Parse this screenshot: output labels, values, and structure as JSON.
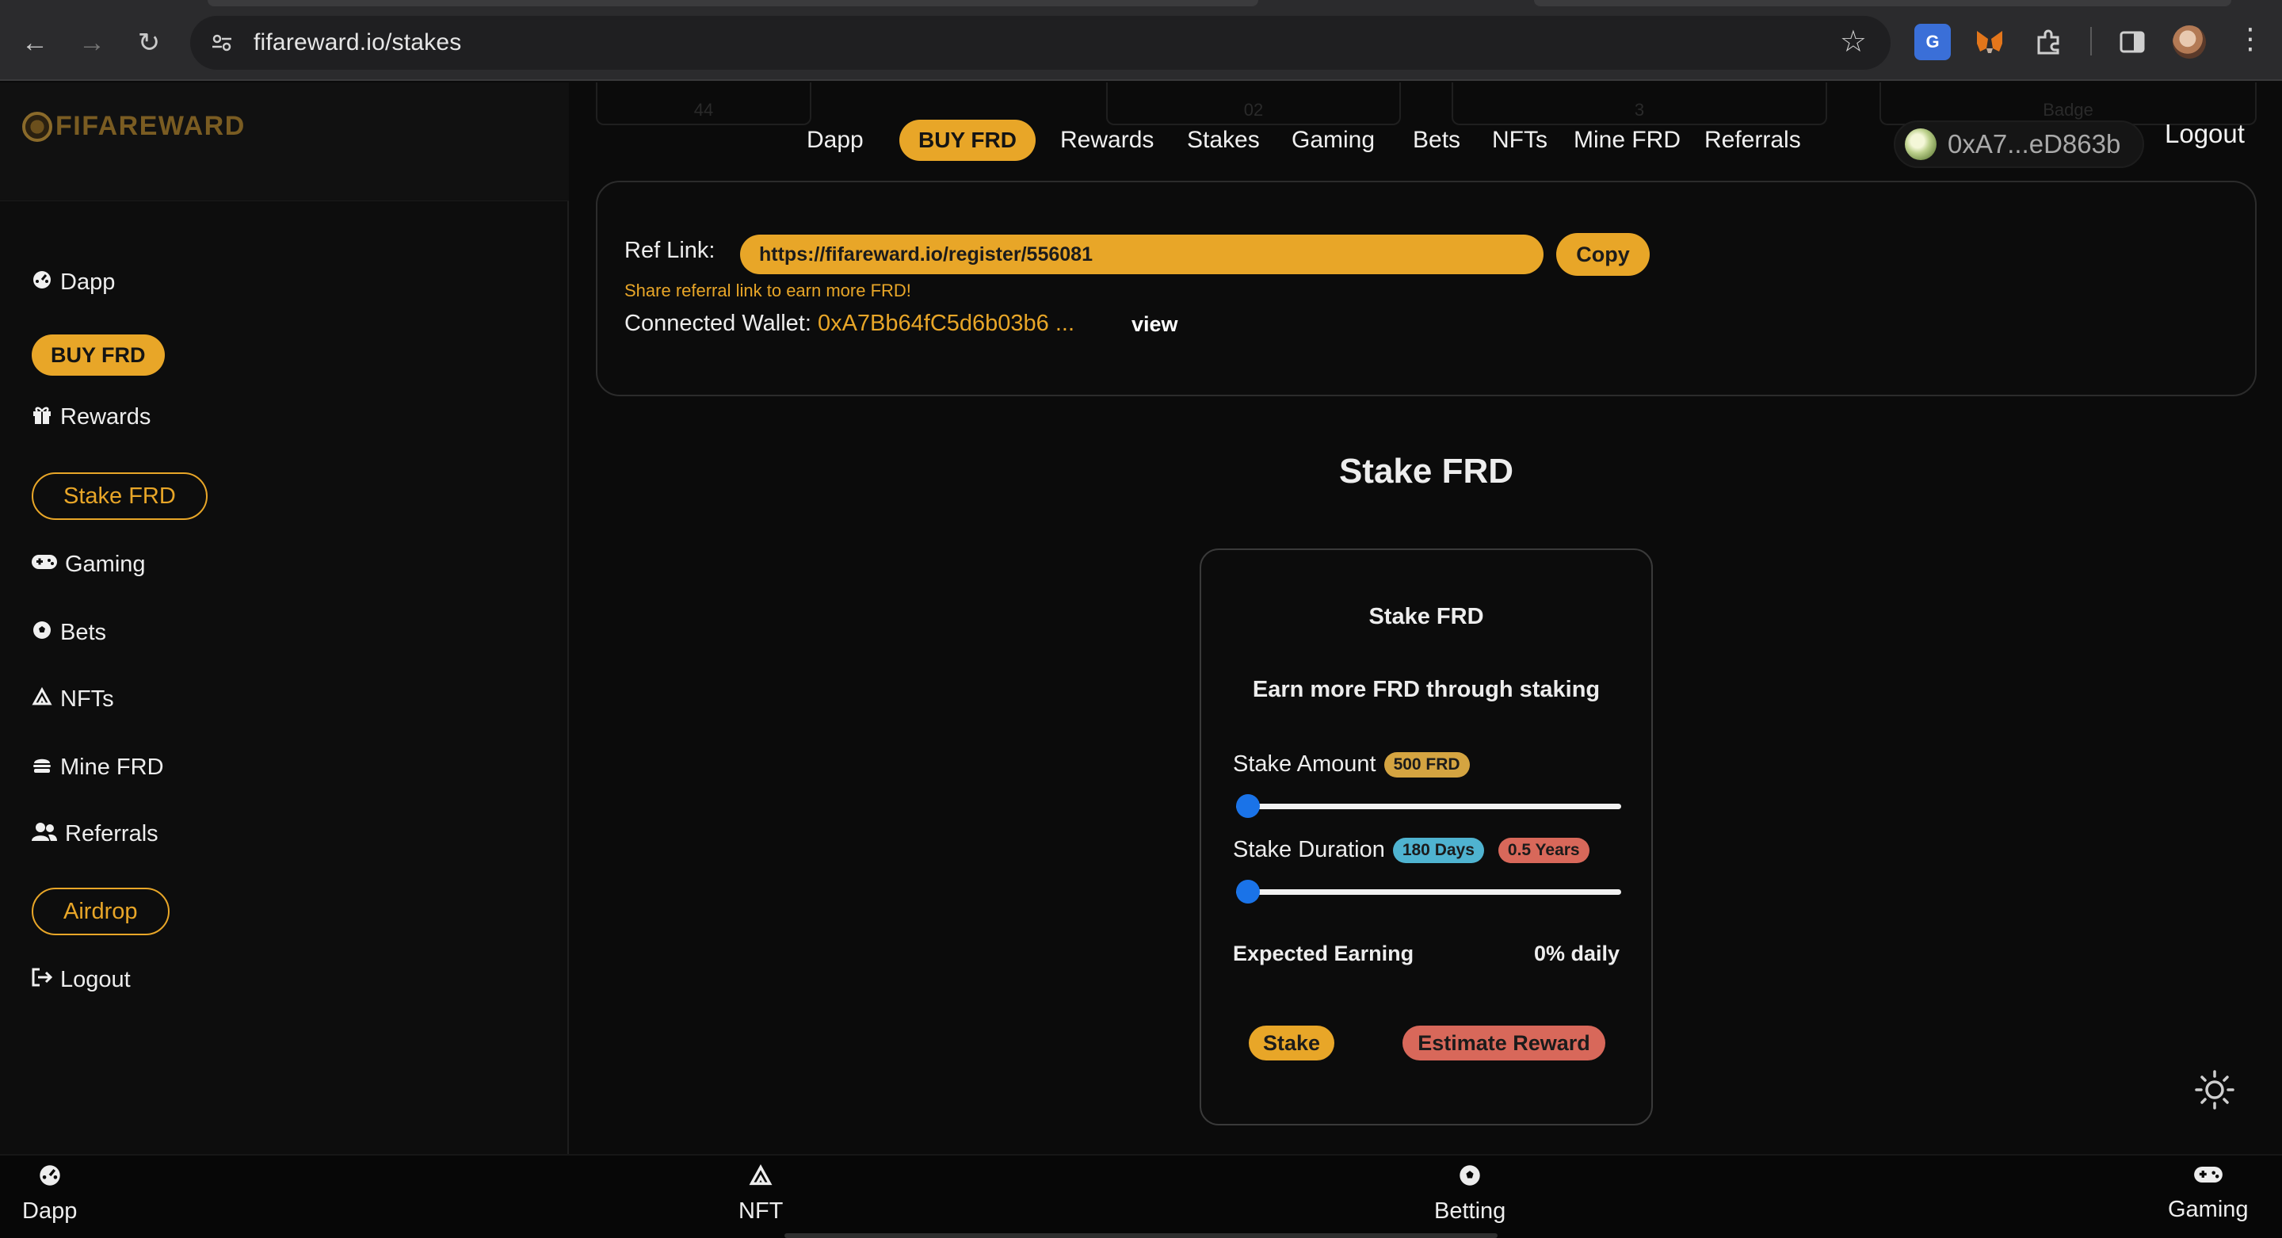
{
  "browser": {
    "url": "fifareward.io/stakes",
    "back_icon": "←",
    "forward_icon": "→",
    "reload_icon": "↻",
    "star_icon": "☆",
    "menu_icon": "⋮"
  },
  "brand": {
    "name": "FIFAREWARD"
  },
  "sidebar": {
    "dapp": "Dapp",
    "buy": "BUY FRD",
    "rewards": "Rewards",
    "stake": "Stake FRD",
    "gaming": "Gaming",
    "bets": "Bets",
    "nfts": "NFTs",
    "mine": "Mine FRD",
    "referrals": "Referrals",
    "airdrop": "Airdrop",
    "logout": "Logout"
  },
  "topnav": {
    "dapp": "Dapp",
    "buy": "BUY FRD",
    "rewards": "Rewards",
    "stakes": "Stakes",
    "gaming": "Gaming",
    "bets": "Bets",
    "nfts": "NFTs",
    "mine": "Mine FRD",
    "referrals": "Referrals",
    "wallet_short": "0xA7...eD863b",
    "logout": "Logout"
  },
  "ghost_tabs": [
    "44",
    "02",
    "3",
    "Badge"
  ],
  "ref": {
    "label": "Ref Link:",
    "link": "https://fifareward.io/register/556081",
    "copy": "Copy",
    "hint": "Share referral link to earn more FRD!",
    "wallet_label": "Connected Wallet:",
    "wallet_value": "0xA7Bb64fC5d6b03b6 ...",
    "view": "view"
  },
  "page_title": "Stake FRD",
  "stake": {
    "title": "Stake FRD",
    "subtitle": "Earn more FRD through staking",
    "amount_label": "Stake Amount",
    "amount_badge": "500 FRD",
    "amount_slider_level": 0,
    "duration_label": "Stake Duration",
    "duration_days": "180 Days",
    "duration_years": "0.5 Years",
    "duration_slider_level": 0,
    "earning_label": "Expected Earning",
    "earning_value": "0% daily",
    "stake_button": "Stake",
    "estimate_button": "Estimate Reward"
  },
  "bottom_nav": {
    "dapp": "Dapp",
    "nft": "NFT",
    "betting": "Betting",
    "gaming": "Gaming"
  },
  "colors": {
    "accent": "#e8a628",
    "danger": "#d8685a",
    "info": "#4fb3d0",
    "slider": "#1a73e8"
  }
}
